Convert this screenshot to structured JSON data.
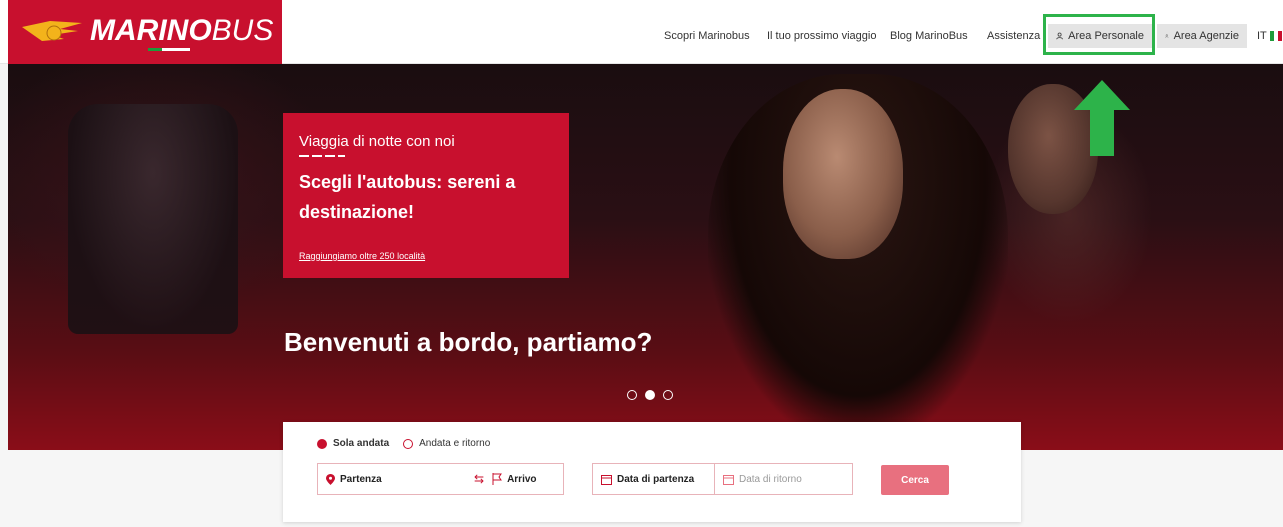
{
  "header": {
    "logo_text_bold": "MARINO",
    "logo_text_light": "BUS",
    "nav": [
      "Scopri Marinobus",
      "Il tuo prossimo viaggio",
      "Blog MarinoBus",
      "Assistenza"
    ],
    "area_personale": "Area Personale",
    "area_agenzie": "Area Agenzie",
    "language": "IT"
  },
  "hero": {
    "promo_kicker": "Viaggia di notte con noi",
    "promo_title": "Scegli l'autobus: sereni a destinazione!",
    "promo_link": "Raggiungiamo oltre 250 località",
    "welcome": "Benvenuti a bordo, partiamo?",
    "carousel_active_index": 1
  },
  "search": {
    "trip_type_options": [
      "Sola andata",
      "Andata e ritorno"
    ],
    "trip_type_selected": "Sola andata",
    "from_placeholder": "Partenza",
    "to_placeholder": "Arrivo",
    "departure_date_placeholder": "Data di partenza",
    "return_date_placeholder": "Data di ritorno",
    "submit_label": "Cerca"
  },
  "colors": {
    "brand_red": "#c8102e",
    "highlight_green": "#2db34a"
  }
}
